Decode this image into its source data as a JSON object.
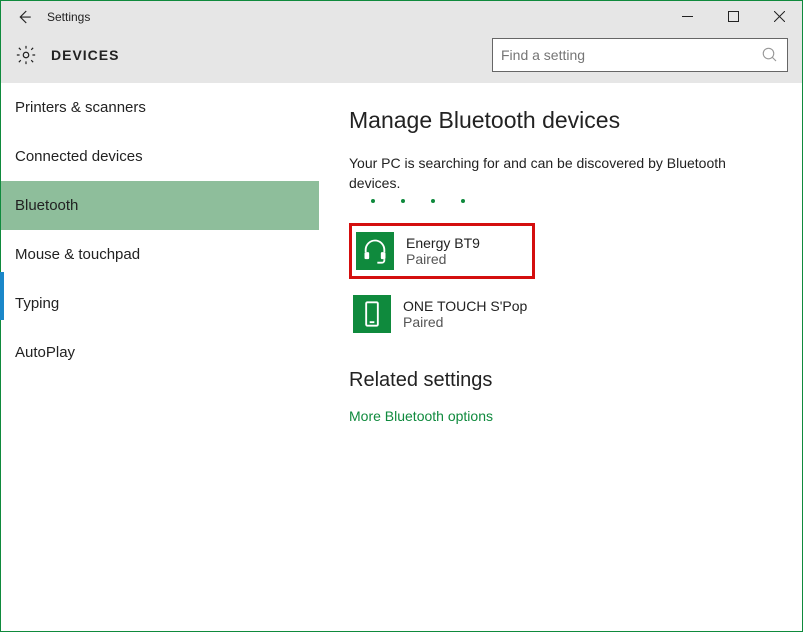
{
  "window": {
    "title": "Settings"
  },
  "header": {
    "section": "DEVICES"
  },
  "search": {
    "placeholder": "Find a setting"
  },
  "sidebar": {
    "items": [
      {
        "label": "Printers & scanners"
      },
      {
        "label": "Connected devices"
      },
      {
        "label": "Bluetooth"
      },
      {
        "label": "Mouse & touchpad"
      },
      {
        "label": "Typing"
      },
      {
        "label": "AutoPlay"
      }
    ]
  },
  "main": {
    "heading": "Manage Bluetooth devices",
    "status": "Your PC is searching for and can be discovered by Bluetooth devices.",
    "devices": [
      {
        "name": "Energy BT9",
        "status": "Paired",
        "icon": "headset",
        "highlighted": true
      },
      {
        "name": "ONE TOUCH S'Pop",
        "status": "Paired",
        "icon": "phone",
        "highlighted": false
      }
    ],
    "related_heading": "Related settings",
    "related_link": "More Bluetooth options"
  },
  "colors": {
    "accent": "#0f8a3d",
    "sidebar_selected": "#8ebe9b",
    "highlight": "#d40e0e"
  }
}
